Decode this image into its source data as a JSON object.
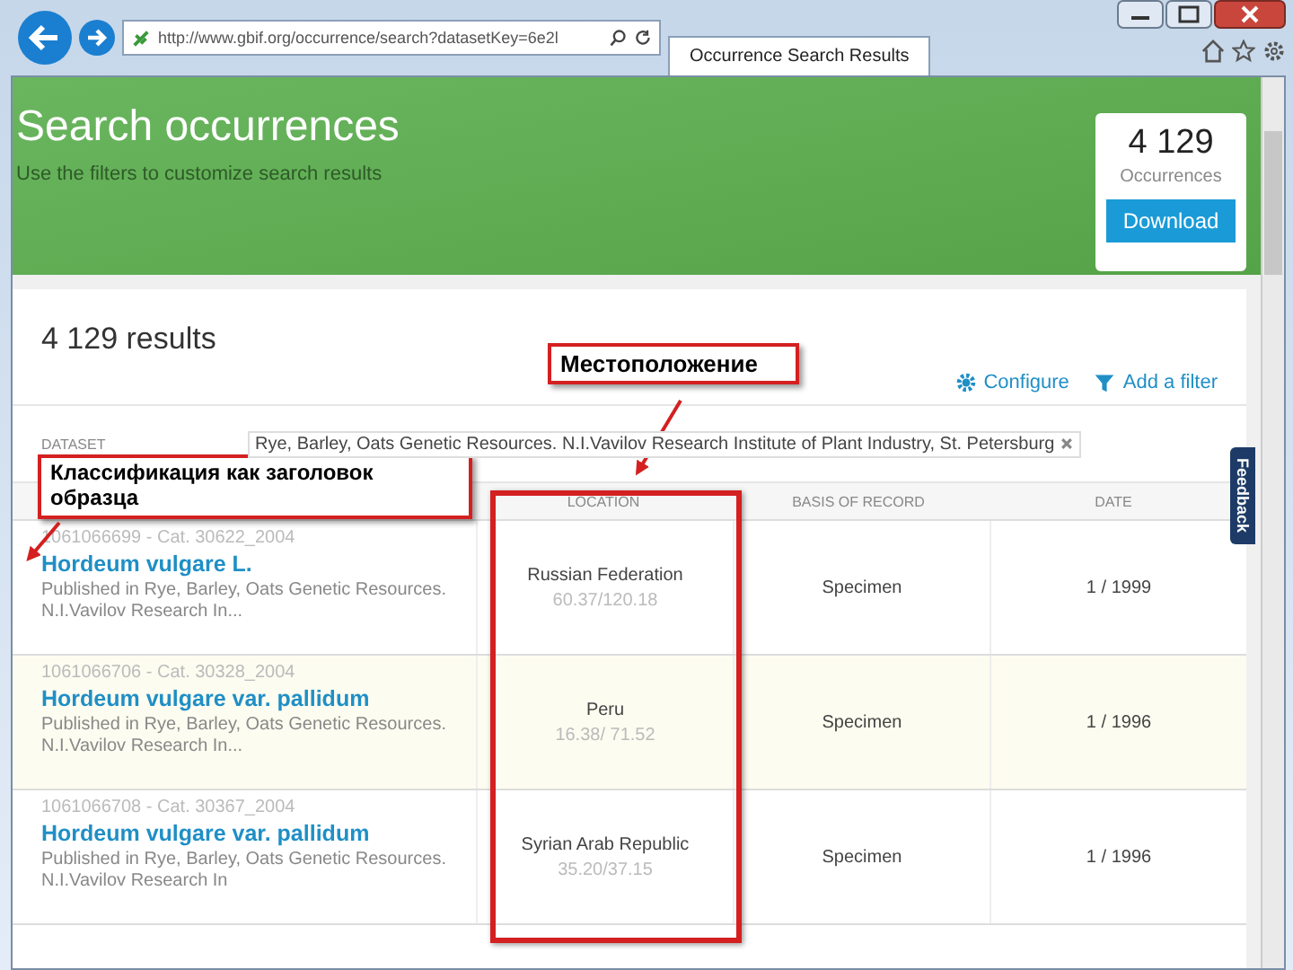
{
  "browser": {
    "url": "http://www.gbif.org/occurrence/search?datasetKey=6e2l",
    "tab_title": "Occurrence Search Results"
  },
  "header": {
    "title": "Search occurrences",
    "subtitle": "Use the filters to customize search results"
  },
  "count_card": {
    "count": "4 129",
    "label": "Occurrences",
    "button": "Download"
  },
  "results_heading": "4 129 results",
  "actions": [
    {
      "kind": "configure",
      "label": "Configure"
    },
    {
      "kind": "filter",
      "label": "Add a filter"
    }
  ],
  "filter": {
    "label": "DATASET",
    "value": "Rye, Barley, Oats Genetic Resources. N.I.Vavilov Research Institute of Plant Industry, St. Petersburg"
  },
  "feedback": "Feedback",
  "table": {
    "columns": [
      "LOCATION",
      "BASIS OF RECORD",
      "DATE"
    ],
    "rows": [
      {
        "id_line": "1061066699 - Cat. 30622_2004",
        "name": "Hordeum vulgare L.",
        "published": "Published in Rye, Barley, Oats Genetic Resources. N.I.Vavilov Research In...",
        "location": "Russian Federation",
        "coords": "60.37/120.18",
        "basis": "Specimen",
        "date": "1 / 1999",
        "highlighted": false
      },
      {
        "id_line": "1061066706 - Cat. 30328_2004",
        "name": "Hordeum vulgare var. pallidum",
        "published": "Published in Rye, Barley, Oats Genetic Resources. N.I.Vavilov Research In...",
        "location": "Peru",
        "coords": "16.38/ 71.52",
        "basis": "Specimen",
        "date": "1 / 1996",
        "highlighted": true
      },
      {
        "id_line": "1061066708 - Cat. 30367_2004",
        "name": "Hordeum vulgare var. pallidum",
        "published": "Published in Rye, Barley, Oats Genetic Resources. N.I.Vavilov Research In",
        "location": "Syrian Arab Republic",
        "coords": "35.20/37.15",
        "basis": "Specimen",
        "date": "1 / 1996",
        "highlighted": false
      }
    ]
  },
  "annotations": [
    {
      "text": "Местоположение"
    },
    {
      "text": "Классификация как заголовок образца"
    }
  ]
}
